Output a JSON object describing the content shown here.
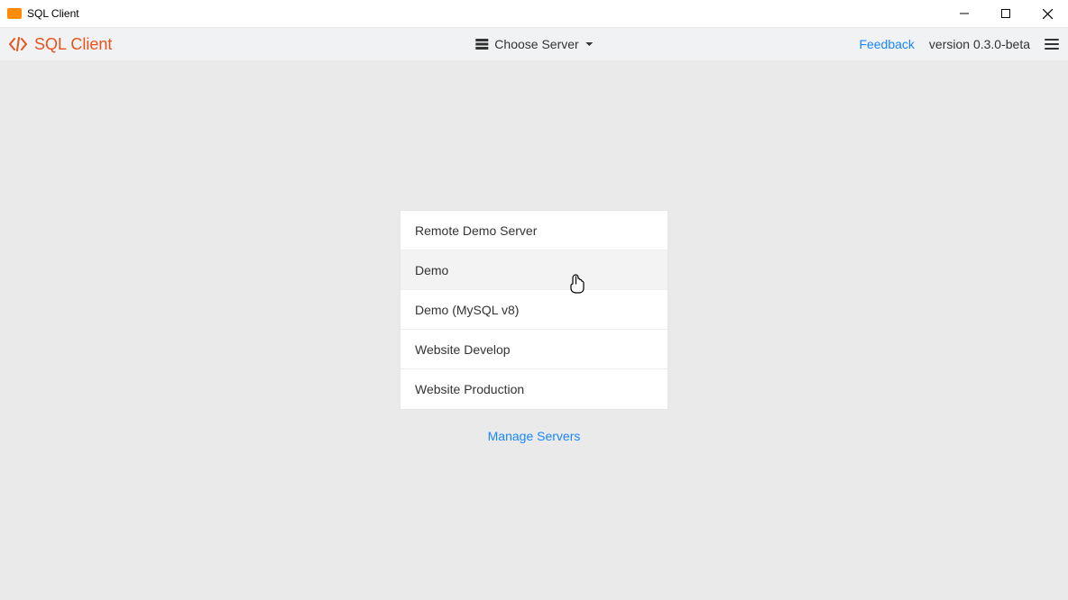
{
  "titlebar": {
    "app_title": "SQL Client"
  },
  "header": {
    "brand_name": "SQL Client",
    "choose_server_label": "Choose Server",
    "feedback_label": "Feedback",
    "version_text": "version 0.3.0-beta"
  },
  "servers": {
    "items": [
      {
        "label": "Remote Demo Server",
        "hovered": false
      },
      {
        "label": "Demo",
        "hovered": true
      },
      {
        "label": "Demo (MySQL v8)",
        "hovered": false
      },
      {
        "label": "Website Develop",
        "hovered": false
      },
      {
        "label": "Website Production",
        "hovered": false
      }
    ],
    "manage_label": "Manage Servers"
  }
}
